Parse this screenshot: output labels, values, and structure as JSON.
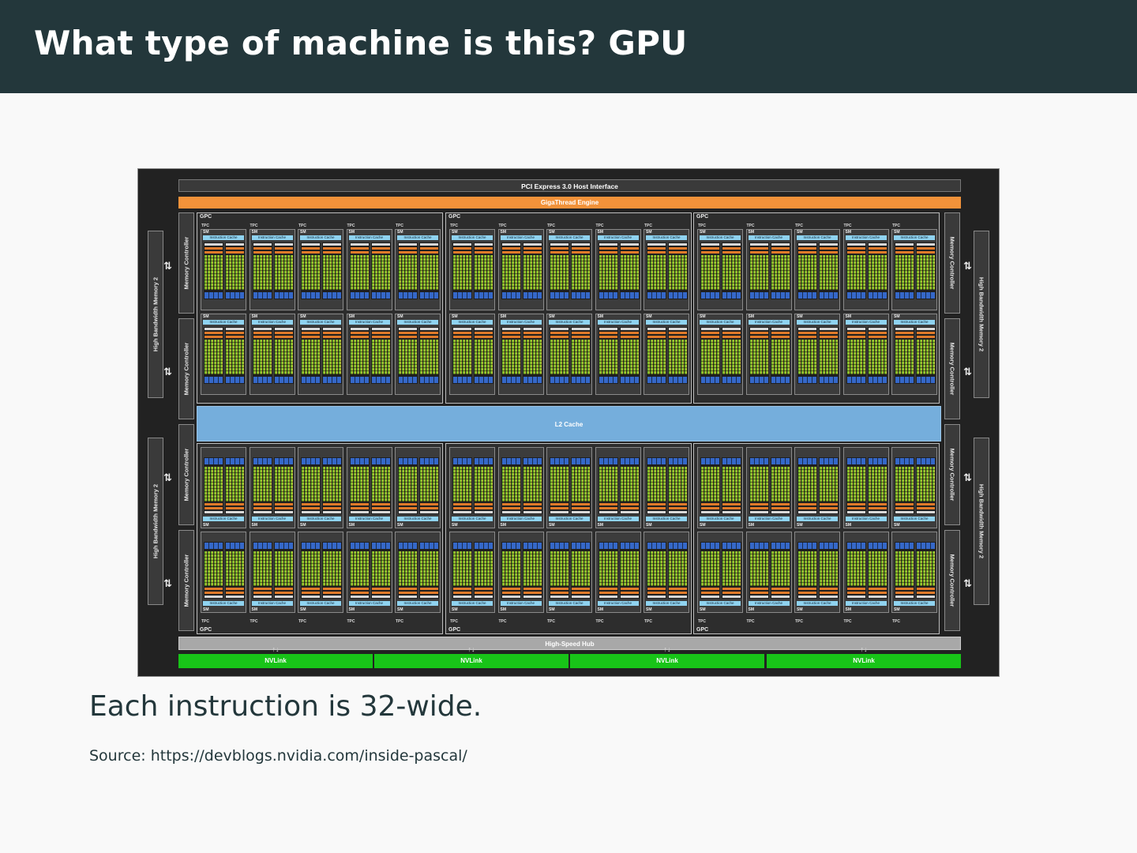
{
  "slide": {
    "title": "What type of machine is this? GPU",
    "body": "Each instruction is 32-wide.",
    "source": "Source:  https://devblogs.nvidia.com/inside-pascal/"
  },
  "diagram": {
    "pcie_label": "PCI Express 3.0 Host Interface",
    "gigathread_label": "GigaThread Engine",
    "l2_label": "L2 Cache",
    "hub_label": "High-Speed Hub",
    "nvlink_labels": [
      "NVLink",
      "NVLink",
      "NVLink",
      "NVLink"
    ],
    "nvlink_arrow": "↑↓",
    "memory_controller_label": "Memory Controller",
    "hbm_label": "High Bandwidth Memory 2",
    "arrow_glyph": "⇅",
    "gpc_label": "GPC",
    "tpc_label": "TPC",
    "sm_label": "SM",
    "instruction_cache_label": "Instruction Cache",
    "colors": {
      "header": "#23373b",
      "gigathread": "#f2923a",
      "l2": "#75aedc",
      "nvlink": "#18c418",
      "core_green": "#7ab82a",
      "core_yellow": "#c7c83a",
      "register_blue": "#3568c9",
      "instruction_cache": "#8fd3f0"
    }
  }
}
